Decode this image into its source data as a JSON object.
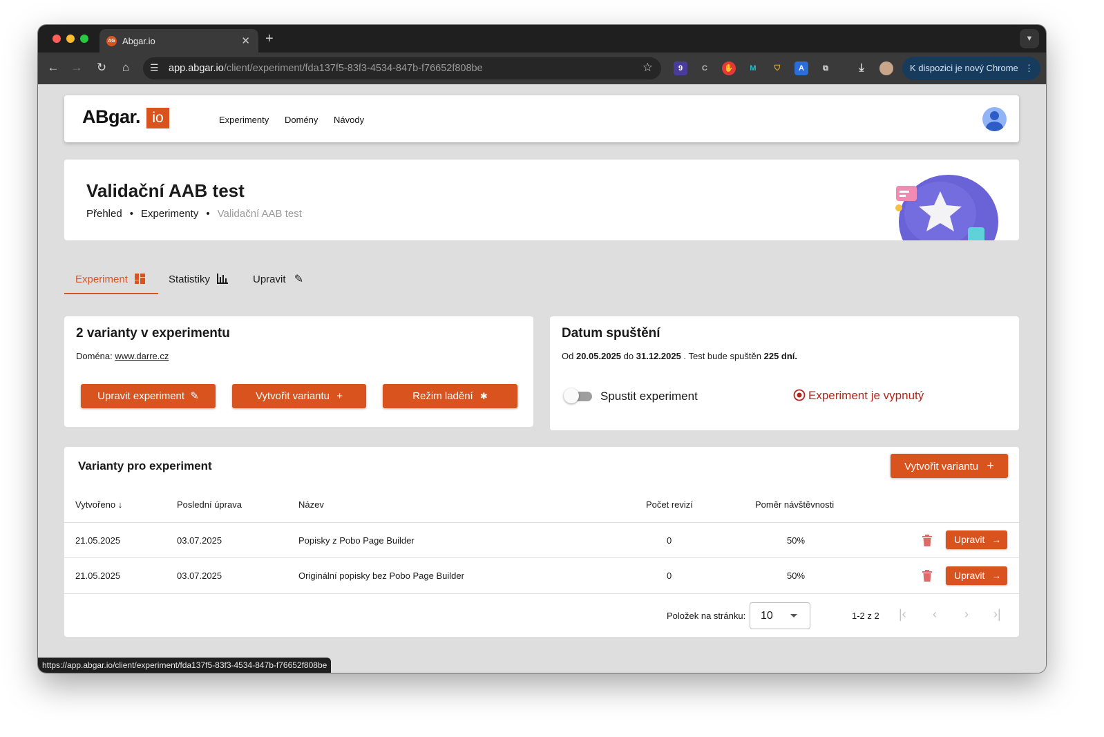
{
  "browser": {
    "tab_title": "Abgar.io",
    "favicon_text": "AG",
    "url_host": "app.abgar.io",
    "url_path": "/client/experiment/fda137f5-83f3-4534-847b-f76652f808be",
    "ext_badge": "9",
    "update_label": "K dispozici je nový Chrome",
    "status_url": "https://app.abgar.io/client/experiment/fda137f5-83f3-4534-847b-f76652f808be"
  },
  "header": {
    "logo_text": "ABgar.",
    "logo_box": "io",
    "nav": [
      "Experimenty",
      "Domény",
      "Návody"
    ]
  },
  "page": {
    "title": "Validační AAB test",
    "breadcrumb": [
      "Přehled",
      "Experimenty",
      "Validační AAB test"
    ]
  },
  "tabs": [
    "Experiment",
    "Statistiky",
    "Upravit"
  ],
  "variants_card": {
    "title": "2 varianty v experimentu",
    "domain_label": "Doména:",
    "domain_value": "www.darre.cz",
    "buttons": [
      "Upravit experiment",
      "Vytvořit variantu",
      "Režim ladění"
    ]
  },
  "date_card": {
    "title": "Datum spuštění",
    "from_label": "Od",
    "from_date": "20.05.2025",
    "to_label": "do",
    "to_date": "31.12.2025",
    "run_text": ". Test bude spuštěn",
    "days": "225 dní.",
    "switch_label": "Spustit experiment",
    "status": "Experiment je vypnutý"
  },
  "table": {
    "title": "Varianty pro experiment",
    "create_label": "Vytvořit variantu",
    "columns": [
      "Vytvořeno",
      "Poslední úprava",
      "Název",
      "Počet revizí",
      "Poměr návštěvnosti"
    ],
    "rows": [
      {
        "created": "21.05.2025",
        "modified": "03.07.2025",
        "name": "Popisky z Pobo Page Builder",
        "revisions": "0",
        "ratio": "50%",
        "edit": "Upravit"
      },
      {
        "created": "21.05.2025",
        "modified": "03.07.2025",
        "name": "Originální popisky bez Pobo Page Builder",
        "revisions": "0",
        "ratio": "50%",
        "edit": "Upravit"
      }
    ],
    "per_page_label": "Položek na stránku:",
    "per_page_value": "10",
    "range": "1-2 z 2"
  },
  "colors": {
    "accent": "#d9531e",
    "status_red": "#b3261e",
    "page_bg": "#dedede"
  }
}
